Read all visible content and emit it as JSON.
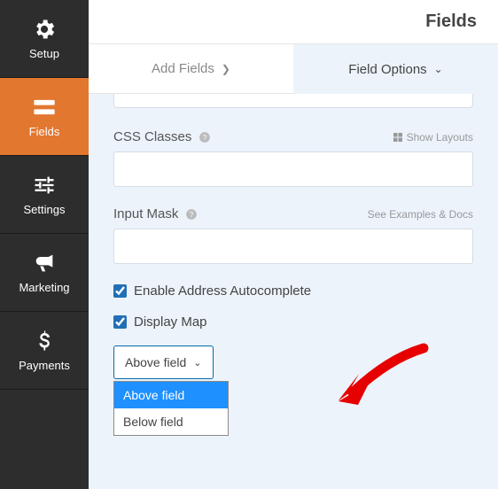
{
  "sidebar": {
    "items": [
      {
        "label": "Setup"
      },
      {
        "label": "Fields"
      },
      {
        "label": "Settings"
      },
      {
        "label": "Marketing"
      },
      {
        "label": "Payments"
      }
    ]
  },
  "header": {
    "title": "Fields"
  },
  "tabs": {
    "add": "Add Fields",
    "options": "Field Options"
  },
  "fields": {
    "css_label": "CSS Classes",
    "show_layouts": "Show Layouts",
    "mask_label": "Input Mask",
    "examples": "See Examples & Docs",
    "enable_autocomplete": "Enable Address Autocomplete",
    "display_map": "Display Map"
  },
  "dropdown": {
    "selected": "Above field",
    "opt1": "Above field",
    "opt2": "Below field"
  }
}
